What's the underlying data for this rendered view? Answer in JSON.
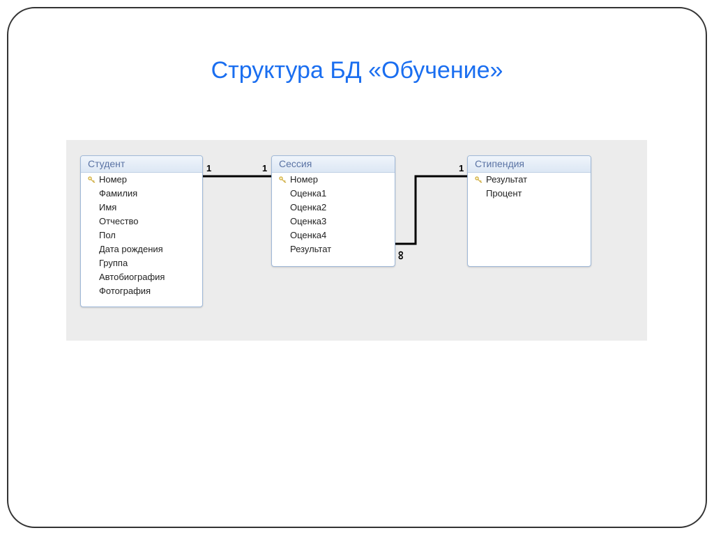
{
  "title": "Структура БД «Обучение»",
  "entities": {
    "student": {
      "name": "Студент",
      "fields": [
        {
          "key": true,
          "label": "Номер"
        },
        {
          "key": false,
          "label": "Фамилия"
        },
        {
          "key": false,
          "label": "Имя"
        },
        {
          "key": false,
          "label": "Отчество"
        },
        {
          "key": false,
          "label": "Пол"
        },
        {
          "key": false,
          "label": "Дата рождения"
        },
        {
          "key": false,
          "label": "Группа"
        },
        {
          "key": false,
          "label": "Автобиография"
        },
        {
          "key": false,
          "label": "Фотография"
        }
      ]
    },
    "session": {
      "name": "Сессия",
      "fields": [
        {
          "key": true,
          "label": "Номер"
        },
        {
          "key": false,
          "label": "Оценка1"
        },
        {
          "key": false,
          "label": "Оценка2"
        },
        {
          "key": false,
          "label": "Оценка3"
        },
        {
          "key": false,
          "label": "Оценка4"
        },
        {
          "key": false,
          "label": "Результат"
        }
      ]
    },
    "scholarship": {
      "name": "Стипендия",
      "fields": [
        {
          "key": true,
          "label": "Результат"
        },
        {
          "key": false,
          "label": "Процент"
        }
      ]
    }
  },
  "relations": {
    "rel1": {
      "leftCard": "1",
      "rightCard": "1"
    },
    "rel2": {
      "leftCard": "∞",
      "rightCard": "1"
    }
  }
}
